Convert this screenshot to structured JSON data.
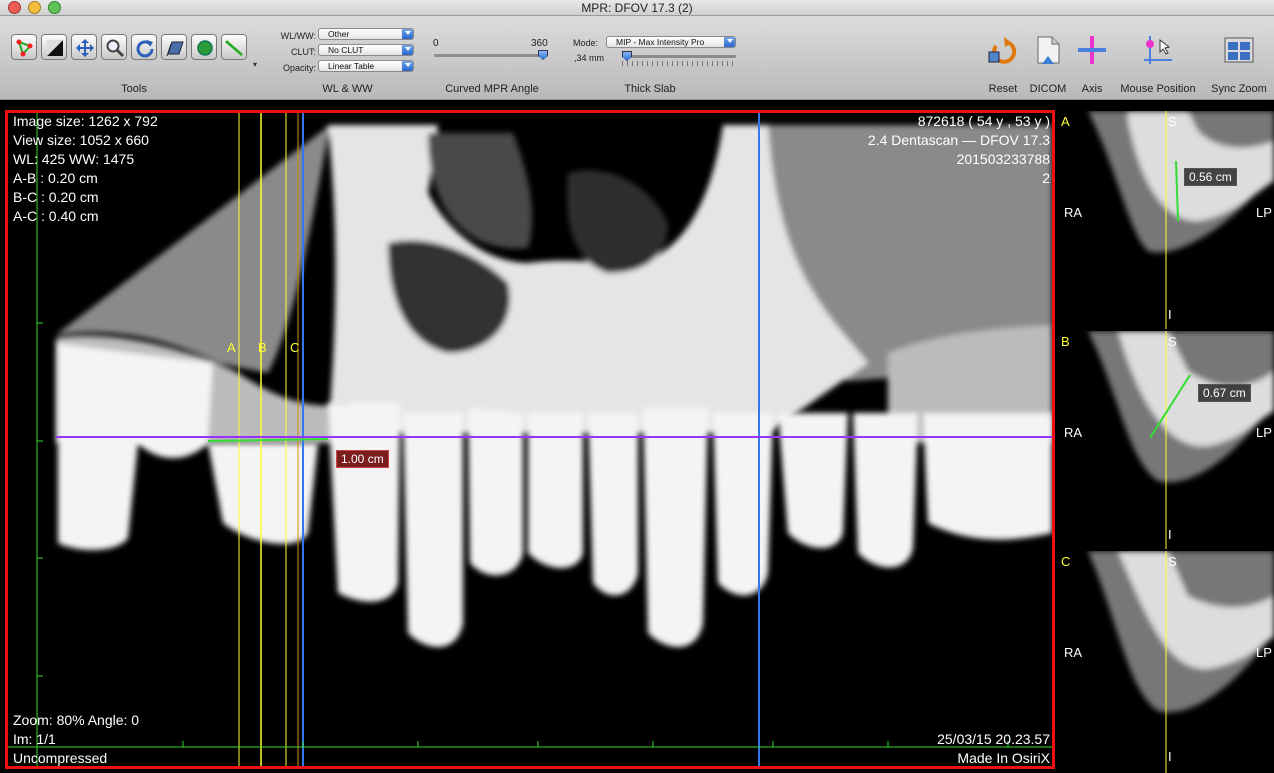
{
  "window": {
    "title": "MPR: DFOV 17.3 (2)"
  },
  "toolbar": {
    "tools_label": "Tools",
    "tools": [
      "roi-tool-icon",
      "wl-ww-tool-icon",
      "pan-tool-icon",
      "zoom-tool-icon",
      "rotate-tool-icon",
      "stack-tool-icon",
      "oval-tool-icon",
      "ruler-tool-icon"
    ],
    "wlww": {
      "group_label": "WL & WW",
      "wlww_label": "WL/WW:",
      "wlww_value": "Other",
      "clut_label": "CLUT:",
      "clut_value": "No CLUT",
      "opacity_label": "Opacity:",
      "opacity_value": "Linear Table"
    },
    "curved": {
      "group_label": "Curved MPR Angle",
      "min": "0",
      "max": "360",
      "value_fraction": 1.0
    },
    "slab": {
      "group_label": "Thick Slab",
      "mode_label": "Mode:",
      "mode_value": "MIP - Max Intensity Pro",
      "thickness": ",34 mm",
      "value_fraction": 0.0
    },
    "right": [
      {
        "label": "Reset",
        "icon": "reset-icon"
      },
      {
        "label": "DICOM",
        "icon": "dicom-icon"
      },
      {
        "label": "Axis",
        "icon": "axis-icon"
      },
      {
        "label": "Mouse Position",
        "icon": "mouse-position-icon"
      },
      {
        "label": "Sync Zoom",
        "icon": "sync-zoom-icon"
      }
    ]
  },
  "main": {
    "top_left": [
      "Image size: 1262 x 792",
      "View size: 1052 x 660",
      "WL: 425 WW: 1475",
      "A-B : 0.20 cm",
      "B-C : 0.20 cm",
      "A-C : 0.40 cm"
    ],
    "top_right": [
      "872618 ( 54 y , 53 y )",
      "2.4 Dentascan — DFOV 17.3",
      "201503233788",
      "2"
    ],
    "bottom_left": [
      "Zoom: 80% Angle: 0",
      "Im: 1/1",
      "Uncompressed"
    ],
    "bottom_right": [
      "25/03/15 20.23.57",
      "Made In OsiriX"
    ],
    "line_labels": [
      "A",
      "B",
      "C"
    ],
    "measurement": "1.00 cm"
  },
  "side": [
    {
      "tag": "A",
      "s": "S",
      "i": "I",
      "ra": "RA",
      "lp": "LP",
      "measure": "0.56 cm"
    },
    {
      "tag": "B",
      "s": "S",
      "i": "I",
      "ra": "RA",
      "lp": "LP",
      "measure": "0.67 cm"
    },
    {
      "tag": "C",
      "s": "S",
      "i": "I",
      "ra": "RA",
      "lp": "LP",
      "measure": ""
    }
  ],
  "colors": {
    "accent_border": "#e11111",
    "slice_line": "#ffff33",
    "axis_line": "#9933ff",
    "blue_line": "#3377ee",
    "measure": "#33dd33"
  }
}
